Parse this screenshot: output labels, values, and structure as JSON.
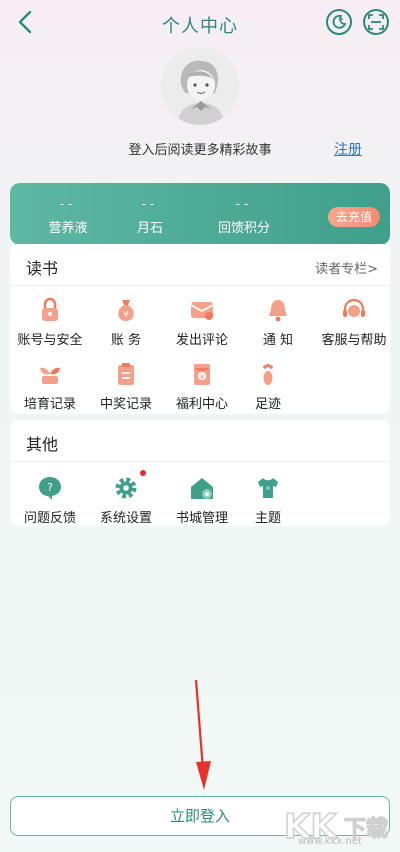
{
  "header": {
    "title": "个人中心"
  },
  "profile": {
    "login_hint": "登入后阅读更多精彩故事",
    "register": "注册"
  },
  "stats": [
    {
      "value": "--",
      "label": "营养液"
    },
    {
      "value": "--",
      "label": "月石"
    },
    {
      "value": "--",
      "label": "回馈积分"
    }
  ],
  "recharge_label": "去充值",
  "reading": {
    "heading": "读书",
    "more": "读者专栏>",
    "items": [
      {
        "label": "账号与安全",
        "icon": "lock-icon"
      },
      {
        "label": "账  务",
        "icon": "money-bag-icon"
      },
      {
        "label": "发出评论",
        "icon": "envelope-icon"
      },
      {
        "label": "通  知",
        "icon": "bell-icon"
      },
      {
        "label": "客服与帮助",
        "icon": "headset-icon"
      },
      {
        "label": "培育记录",
        "icon": "sprout-icon"
      },
      {
        "label": "中奖记录",
        "icon": "clipboard-icon"
      },
      {
        "label": "福利中心",
        "icon": "red-envelope-icon"
      },
      {
        "label": "足迹",
        "icon": "footprint-icon"
      }
    ]
  },
  "other": {
    "heading": "其他",
    "items": [
      {
        "label": "问题反馈",
        "icon": "question-icon"
      },
      {
        "label": "系统设置",
        "icon": "gear-icon"
      },
      {
        "label": "书城管理",
        "icon": "house-gear-icon"
      },
      {
        "label": "主题",
        "icon": "shirt-icon"
      }
    ]
  },
  "login_button": "立即登入",
  "watermark": {
    "brand": "KK下载",
    "url": "www.kkx.net"
  },
  "colors": {
    "accent": "#2a8a79",
    "card": "#4aa890",
    "icon_red": "#f07a5c",
    "link": "#2a78c8"
  }
}
